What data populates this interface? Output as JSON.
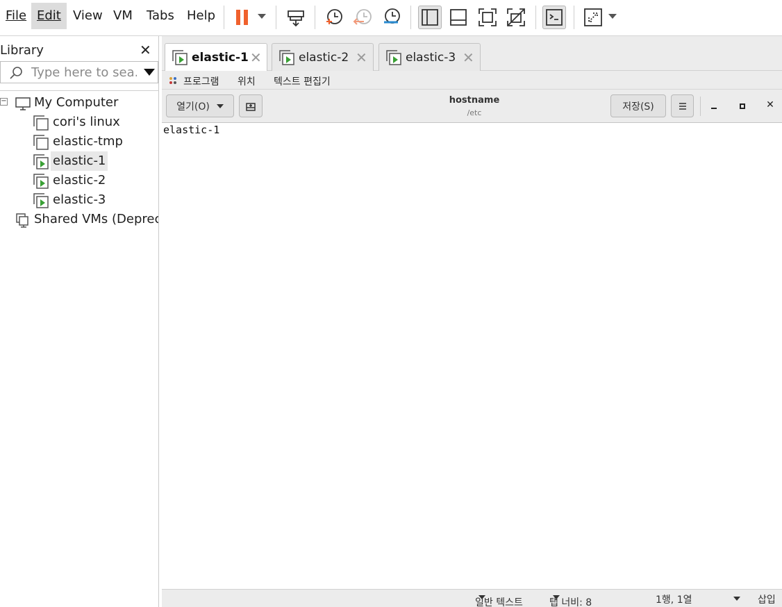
{
  "menubar": {
    "items": [
      {
        "label": "File",
        "underline_index": 0
      },
      {
        "label": "Edit",
        "underline_index": 0
      },
      {
        "label": "View",
        "underline_index": 0
      },
      {
        "label": "VM",
        "underline_index": 1
      },
      {
        "label": "Tabs",
        "underline_index": 0
      },
      {
        "label": "Help",
        "underline_index": 0
      }
    ],
    "active_index": 1
  },
  "toolbar": {
    "icons": [
      "pause-icon",
      "send-keys-icon",
      "take-snapshot-icon",
      "revert-snapshot-icon",
      "manage-snapshots-icon",
      "show-library-icon",
      "show-thumbnail-bar-icon",
      "full-screen-icon",
      "unity-icon",
      "console-view-icon",
      "stretch-guest-icon"
    ],
    "pause_color": "#f0612d",
    "revert_color": "#f29a7a",
    "manage_color": "#2a8bd0"
  },
  "library": {
    "title": "Library",
    "search_placeholder": "Type here to sea...",
    "tree": [
      {
        "label": "My Computer",
        "level": 0,
        "kind": "computer",
        "expanded": true
      },
      {
        "label": "cori's linux",
        "level": 1,
        "kind": "vm-off"
      },
      {
        "label": "elastic-tmp",
        "level": 1,
        "kind": "vm-off"
      },
      {
        "label": "elastic-1",
        "level": 1,
        "kind": "vm-running",
        "selected": true
      },
      {
        "label": "elastic-2",
        "level": 1,
        "kind": "vm-running"
      },
      {
        "label": "elastic-3",
        "level": 1,
        "kind": "vm-running"
      },
      {
        "label": "Shared VMs (Deprecated)",
        "display": "Shared VMs (Depreca",
        "level": 0,
        "kind": "shared"
      }
    ]
  },
  "vm_tabs": [
    {
      "label": "elastic-1",
      "active": true
    },
    {
      "label": "elastic-2",
      "active": false
    },
    {
      "label": "elastic-3",
      "active": false
    }
  ],
  "guest": {
    "topbar": {
      "programs": "프로그램",
      "places": "위치",
      "app": "텍스트 편집기"
    },
    "header": {
      "open_label": "열기(O)",
      "title": "hostname",
      "subtitle": "/etc",
      "save_label": "저장(S)"
    },
    "document_text": "elastic-1",
    "status": {
      "syntax": "일반 텍스트",
      "tab_width": "탭 너비: 8",
      "position": "1행, 1열",
      "mode": "삽입"
    }
  },
  "colors": {
    "vm_running_green": "#3aa035",
    "selection_bg": "#e8e8e8"
  }
}
